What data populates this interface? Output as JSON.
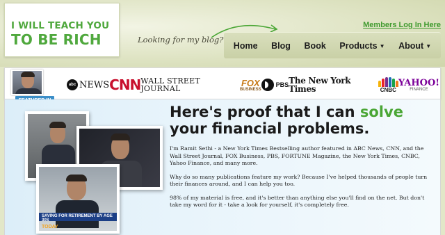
{
  "header": {
    "logo_line1": "I WILL TEACH YOU",
    "logo_line2": "TO BE RICH",
    "tagline": "Looking for my blog?",
    "members_link": "Members Log In Here",
    "nav": [
      {
        "label": "Home",
        "has_caret": false
      },
      {
        "label": "Blog",
        "has_caret": false
      },
      {
        "label": "Book",
        "has_caret": false
      },
      {
        "label": "Products",
        "has_caret": true
      },
      {
        "label": "About",
        "has_caret": true
      }
    ],
    "caret_glyph": "▼"
  },
  "featured": {
    "badge": "FEATURED IN",
    "logos": {
      "abc_mark": "abc",
      "abc_word": "NEWS",
      "cnn": "CNN",
      "wsj": "WALL STREET JOURNAL",
      "fox_big": "FOX",
      "fox_small": "BUSINESS",
      "pbs": "PBS",
      "nyt": "The New York Times",
      "nbc": "CNBC",
      "yahoo_big": "YAHOO!",
      "yahoo_small": "FINANCE"
    }
  },
  "main": {
    "headline_before": "Here's proof that I can ",
    "headline_highlight": "solve",
    "headline_after": " your financial problems.",
    "paragraphs": [
      "I'm Ramit Sethi - a New York Times Bestselling author featured in ABC News, CNN, and the Wall Street Journal, FOX Business, PBS, FORTUNE Magazine, the New York Times, CNBC, Yahoo Finance, and many more.",
      "Why do so many publications feature my work? Because I've helped thousands of people turn their finances around, and I can help you too.",
      "98% of my material is free, and it's better than anything else you'll find on the net. But don't take my word for it - take a look for yourself, it's completely free."
    ],
    "tv_caption": "SAVING FOR RETIREMENT BY AGE 30S",
    "tv_logo": "TODAY"
  },
  "colors": {
    "brand_green": "#4fa83d",
    "solve_green": "#4aa635",
    "link_green": "#3f9a2e",
    "cnn_red": "#c8102e",
    "badge_blue": "#3b8ec8"
  }
}
